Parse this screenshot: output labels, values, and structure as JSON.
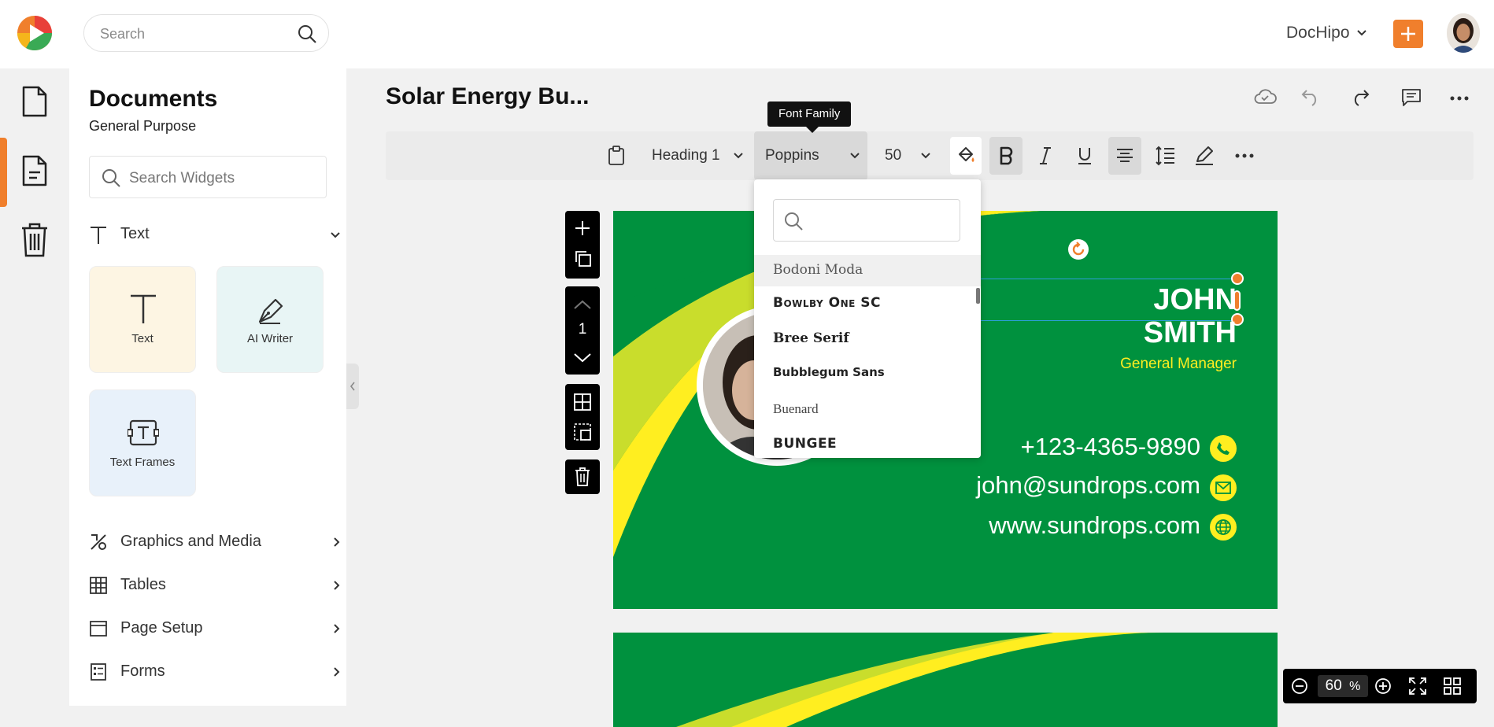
{
  "header": {
    "search_placeholder": "Search",
    "brand": "DocHipo"
  },
  "panel": {
    "title": "Documents",
    "subtitle": "General Purpose",
    "widget_search_placeholder": "Search Widgets",
    "text_section": "Text",
    "tiles": [
      {
        "label": "Text",
        "icon": "text-icon"
      },
      {
        "label": "AI Writer",
        "icon": "pen-icon"
      },
      {
        "label": "Text Frames",
        "icon": "text-frame-icon"
      }
    ],
    "categories": [
      {
        "label": "Graphics and Media",
        "icon": "graphics-icon"
      },
      {
        "label": "Tables",
        "icon": "table-icon"
      },
      {
        "label": "Page Setup",
        "icon": "page-setup-icon"
      },
      {
        "label": "Forms",
        "icon": "forms-icon"
      }
    ]
  },
  "document": {
    "title": "Solar Energy Bu..."
  },
  "toolbar": {
    "heading": "Heading 1",
    "font": "Poppins",
    "size": "50",
    "tooltip": "Font Family"
  },
  "page_controls": {
    "page_number": "1"
  },
  "font_dropdown": {
    "items": [
      "Bodoni Moda",
      "Bowlby One SC",
      "Bree Serif",
      "Bubblegum Sans",
      "Buenard",
      "BUNGEE"
    ]
  },
  "card": {
    "name_line1": "JOHN",
    "name_line2": "SMITH",
    "role": "General Manager",
    "phone": "+123-4365-9890",
    "email": "john@sundrops.com",
    "website": "www.sundrops.com"
  },
  "zoom": {
    "value": "60",
    "unit": "%"
  },
  "colors": {
    "accent": "#f07f2c",
    "card_green": "#00913e",
    "card_yellow": "#ffee20"
  }
}
